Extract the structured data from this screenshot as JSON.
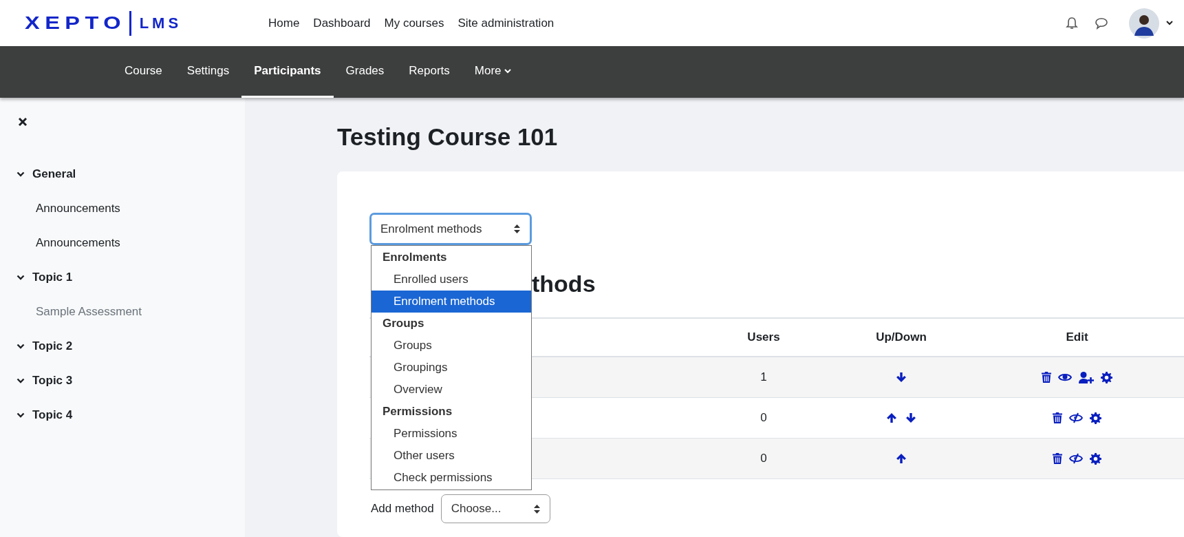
{
  "brand": {
    "name": "XEPTO",
    "product": "LMS"
  },
  "primary_nav": [
    {
      "label": "Home"
    },
    {
      "label": "Dashboard"
    },
    {
      "label": "My courses"
    },
    {
      "label": "Site administration"
    }
  ],
  "secondary_nav": [
    {
      "label": "Course",
      "selected": false
    },
    {
      "label": "Settings",
      "selected": false
    },
    {
      "label": "Participants",
      "selected": true
    },
    {
      "label": "Grades",
      "selected": false
    },
    {
      "label": "Reports",
      "selected": false
    },
    {
      "label": "More",
      "selected": false,
      "kind": "menu"
    }
  ],
  "sidebar": {
    "sections": [
      {
        "title": "General",
        "expanded": true,
        "items": [
          {
            "label": "Announcements",
            "dimmed": false
          },
          {
            "label": "Announcements",
            "dimmed": false
          }
        ]
      },
      {
        "title": "Topic 1",
        "expanded": true,
        "items": [
          {
            "label": "Sample Assessment",
            "dimmed": true
          }
        ]
      },
      {
        "title": "Topic 2",
        "expanded": true
      },
      {
        "title": "Topic 3",
        "expanded": true
      },
      {
        "title": "Topic 4",
        "expanded": true
      }
    ]
  },
  "page_title": "Testing Course 101",
  "page_select": {
    "value": "Enrolment methods",
    "expanded": true,
    "groups": [
      {
        "label": "Enrolments",
        "options": [
          {
            "label": "Enrolled users",
            "selected": false
          },
          {
            "label": "Enrolment methods",
            "selected": true
          }
        ]
      },
      {
        "label": "Groups",
        "options": [
          {
            "label": "Groups",
            "selected": false
          },
          {
            "label": "Groupings",
            "selected": false
          },
          {
            "label": "Overview",
            "selected": false
          }
        ]
      },
      {
        "label": "Permissions",
        "options": [
          {
            "label": "Permissions",
            "selected": false
          },
          {
            "label": "Other users",
            "selected": false
          },
          {
            "label": "Check permissions",
            "selected": false
          }
        ]
      }
    ]
  },
  "section_heading": "thods",
  "table": {
    "columns": [
      "Users",
      "Up/Down",
      "Edit"
    ],
    "rows": [
      {
        "users": "1",
        "up": false,
        "down": true,
        "edit_icons": [
          {
            "kind": "delete"
          },
          {
            "kind": "visible"
          },
          {
            "kind": "enrol"
          },
          {
            "kind": "settings"
          }
        ]
      },
      {
        "users": "0",
        "up": true,
        "down": true,
        "edit_icons": [
          {
            "kind": "delete"
          },
          {
            "kind": "hidden"
          },
          {
            "kind": "settings"
          }
        ]
      },
      {
        "users": "0",
        "up": true,
        "down": false,
        "edit_icons": [
          {
            "kind": "delete"
          },
          {
            "kind": "hidden"
          },
          {
            "kind": "settings"
          }
        ]
      }
    ]
  },
  "add_method": {
    "label": "Add method",
    "value": "Choose..."
  }
}
